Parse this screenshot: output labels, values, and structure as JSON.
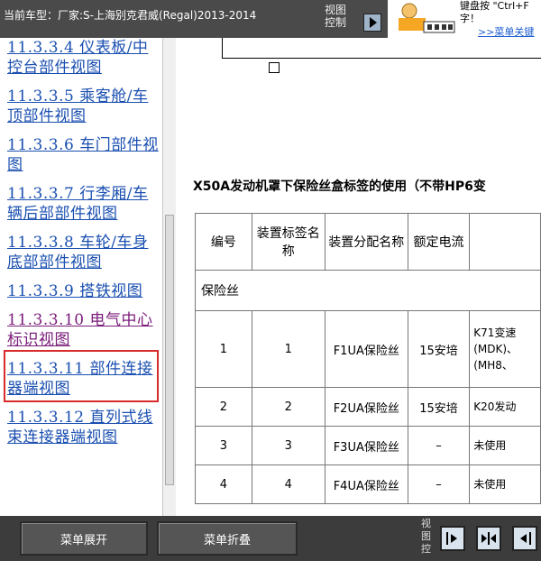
{
  "header": {
    "vehicle_text": "当前车型：厂家:S-上海别克君威(Regal)2013-2014",
    "view_ctrl_line1": "视图",
    "view_ctrl_line2": "控制",
    "ad_line1": "键盘按 \"Ctrl+F",
    "ad_line2": "字！",
    "ad_link": ">>菜单关键"
  },
  "sidebar": {
    "items": [
      "11.3.3.4 仪表板/中控台部件视图",
      "11.3.3.5 乘客舱/车顶部件视图",
      "11.3.3.6 车门部件视图",
      "11.3.3.7 行李厢/车辆后部部件视图",
      "11.3.3.8 车轮/车身底部部件视图",
      "11.3.3.9 搭铁视图",
      "11.3.3.10 电气中心标识视图",
      "11.3.3.11 部件连接器端视图",
      "11.3.3.12 直列式线束连接器端视图"
    ]
  },
  "main": {
    "section_title": "X50A发动机罩下保险丝盒标签的使用（不带HP6变",
    "table": {
      "headers": [
        "编号",
        "装置标签名称",
        "装置分配名称",
        "额定电流",
        ""
      ],
      "subhead": "保险丝",
      "rows": [
        [
          "1",
          "1",
          "F1UA保险丝",
          "15安培",
          "K71变速(MDK)、(MH8、"
        ],
        [
          "2",
          "2",
          "F2UA保险丝",
          "15安培",
          "K20发动"
        ],
        [
          "3",
          "3",
          "F3UA保险丝",
          "–",
          "未使用"
        ],
        [
          "4",
          "4",
          "F4UA保险丝",
          "–",
          "未使用"
        ]
      ]
    }
  },
  "footer": {
    "expand_label": "菜单展开",
    "collapse_label": "菜单折叠",
    "view_ctrl_label": "视图控"
  }
}
